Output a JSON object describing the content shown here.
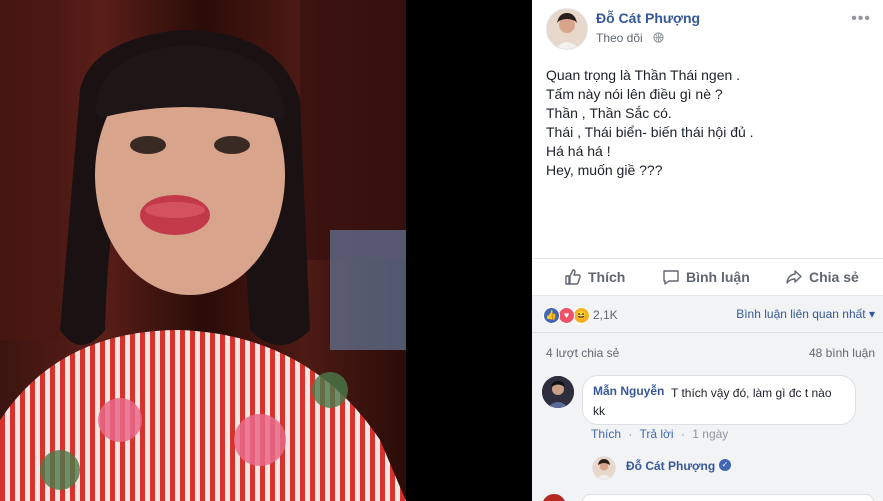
{
  "post": {
    "author": "Đỗ Cát Phượng",
    "follow_label": "Theo dõi",
    "privacy_icon": "globe-icon",
    "more_label": "•••",
    "text_lines": [
      "Quan trọng là Thần Thái ngen .",
      "Tấm này nói lên điều gì nè ?",
      "Thần , Thần Sắc có.",
      "Thái , Thái biển- biến thái hội đủ .",
      "Há há há !",
      "Hey, muốn giề ???"
    ]
  },
  "actions": {
    "like_label": "Thích",
    "comment_label": "Bình luận",
    "share_label": "Chia sẻ"
  },
  "reactions": {
    "icons": [
      "like",
      "love",
      "haha"
    ],
    "count": "2,1K",
    "sort_label": "Bình luận liên quan nhất ▾"
  },
  "stats": {
    "shares": "4 lượt chia sẻ",
    "comments": "48 bình luận"
  },
  "comments": [
    {
      "name": "Mẫn Nguyễn",
      "text": "T thích vậy đó, làm gì đc t nào kk",
      "like_label": "Thích",
      "reply_label": "Trả lời",
      "time": "1 ngày"
    }
  ],
  "reply": {
    "name": "Đỗ Cát Phượng",
    "verified": "✓"
  },
  "colors": {
    "link": "#365899",
    "like_blue": "#4267b2",
    "love_red": "#f25268",
    "haha_yellow": "#f7b125"
  }
}
